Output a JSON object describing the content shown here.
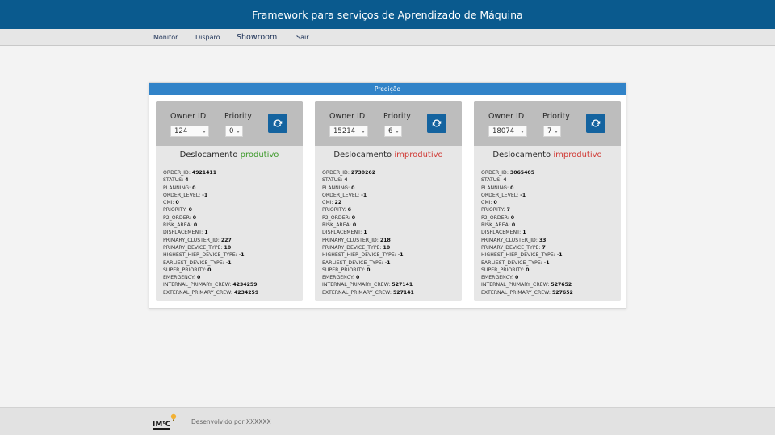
{
  "header": {
    "title": "Framework para serviços de Aprendizado de Máquina"
  },
  "nav": {
    "monitor": "Monitor",
    "disparo": "Disparo",
    "showroom": "Showroom",
    "sair": "Sair"
  },
  "panel": {
    "title": "Predição"
  },
  "cards": [
    {
      "owner_label": "Owner ID",
      "owner_value": "124",
      "priority_label": "Priority",
      "priority_value": "0",
      "title_prefix": "Deslocamento",
      "status": "produtivo",
      "fields": [
        {
          "key": "ORDER_ID:",
          "value": "4921411"
        },
        {
          "key": "STATUS:",
          "value": "4"
        },
        {
          "key": "PLANNING:",
          "value": "0"
        },
        {
          "key": "ORDER_LEVEL:",
          "value": "-1"
        },
        {
          "key": "CMI:",
          "value": "0"
        },
        {
          "key": "PRIORITY:",
          "value": "0"
        },
        {
          "key": "P2_ORDER:",
          "value": "0"
        },
        {
          "key": "RISK_AREA:",
          "value": "0"
        },
        {
          "key": "DISPLACEMENT:",
          "value": "1"
        },
        {
          "key": "PRIMARY_CLUSTER_ID:",
          "value": "227"
        },
        {
          "key": "PRIMARY_DEVICE_TYPE:",
          "value": "10"
        },
        {
          "key": "HIGHEST_HIER_DEVICE_TYPE:",
          "value": "-1"
        },
        {
          "key": "EARLIEST_DEVICE_TYPE:",
          "value": "-1"
        },
        {
          "key": "SUPER_PRIORITY:",
          "value": "0"
        },
        {
          "key": "EMERGENCY:",
          "value": "0"
        },
        {
          "key": "INTERNAL_PRIMARY_CREW:",
          "value": "4234259"
        },
        {
          "key": "EXTERNAL_PRIMARY_CREW:",
          "value": "4234259"
        }
      ]
    },
    {
      "owner_label": "Owner ID",
      "owner_value": "15214",
      "priority_label": "Priority",
      "priority_value": "6",
      "title_prefix": "Deslocamento",
      "status": "improdutivo",
      "fields": [
        {
          "key": "ORDER_ID:",
          "value": "2730262"
        },
        {
          "key": "STATUS:",
          "value": "4"
        },
        {
          "key": "PLANNING:",
          "value": "0"
        },
        {
          "key": "ORDER_LEVEL:",
          "value": "-1"
        },
        {
          "key": "CMI:",
          "value": "22"
        },
        {
          "key": "PRIORITY:",
          "value": "6"
        },
        {
          "key": "P2_ORDER:",
          "value": "0"
        },
        {
          "key": "RISK_AREA:",
          "value": "0"
        },
        {
          "key": "DISPLACEMENT:",
          "value": "1"
        },
        {
          "key": "PRIMARY_CLUSTER_ID:",
          "value": "218"
        },
        {
          "key": "PRIMARY_DEVICE_TYPE:",
          "value": "10"
        },
        {
          "key": "HIGHEST_HIER_DEVICE_TYPE:",
          "value": "-1"
        },
        {
          "key": "EARLIEST_DEVICE_TYPE:",
          "value": "-1"
        },
        {
          "key": "SUPER_PRIORITY:",
          "value": "0"
        },
        {
          "key": "EMERGENCY:",
          "value": "0"
        },
        {
          "key": "INTERNAL_PRIMARY_CREW:",
          "value": "527141"
        },
        {
          "key": "EXTERNAL_PRIMARY_CREW:",
          "value": "527141"
        }
      ]
    },
    {
      "owner_label": "Owner ID",
      "owner_value": "18074",
      "priority_label": "Priority",
      "priority_value": "7",
      "title_prefix": "Deslocamento",
      "status": "improdutivo",
      "fields": [
        {
          "key": "ORDER_ID:",
          "value": "3065405"
        },
        {
          "key": "STATUS:",
          "value": "4"
        },
        {
          "key": "PLANNING:",
          "value": "0"
        },
        {
          "key": "ORDER_LEVEL:",
          "value": "-1"
        },
        {
          "key": "CMI:",
          "value": "0"
        },
        {
          "key": "PRIORITY:",
          "value": "7"
        },
        {
          "key": "P2_ORDER:",
          "value": "0"
        },
        {
          "key": "RISK_AREA:",
          "value": "0"
        },
        {
          "key": "DISPLACEMENT:",
          "value": "1"
        },
        {
          "key": "PRIMARY_CLUSTER_ID:",
          "value": "33"
        },
        {
          "key": "PRIMARY_DEVICE_TYPE:",
          "value": "7"
        },
        {
          "key": "HIGHEST_HIER_DEVICE_TYPE:",
          "value": "-1"
        },
        {
          "key": "EARLIEST_DEVICE_TYPE:",
          "value": "-1"
        },
        {
          "key": "SUPER_PRIORITY:",
          "value": "0"
        },
        {
          "key": "EMERGENCY:",
          "value": "0"
        },
        {
          "key": "INTERNAL_PRIMARY_CREW:",
          "value": "527652"
        },
        {
          "key": "EXTERNAL_PRIMARY_CREW:",
          "value": "527652"
        }
      ]
    }
  ],
  "footer": {
    "text": "Desenvolvido por XXXXXX",
    "logo_text": "IMᵗC"
  },
  "icons": {
    "refresh": "refresh-icon",
    "dropdown": "chevron-down-icon",
    "logo": "lightbulb-logo"
  },
  "colors": {
    "header": "#0a5a8e",
    "panel_header": "#3183c8",
    "button": "#14639f",
    "produtivo": "#3e9a2b",
    "improdutivo": "#d03a35"
  }
}
